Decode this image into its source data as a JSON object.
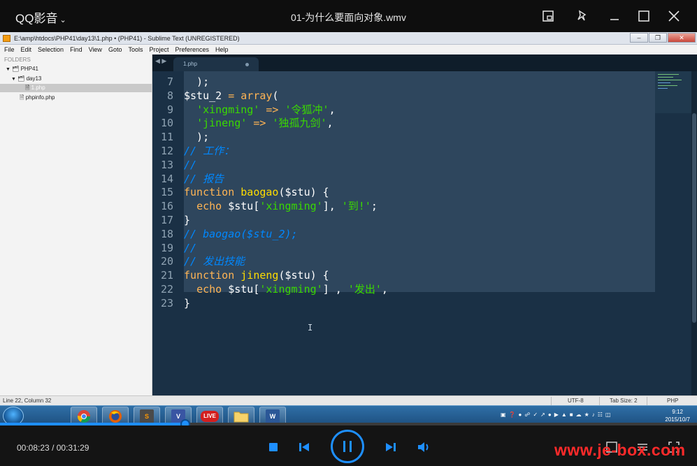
{
  "player": {
    "brand": "QQ影音",
    "video_title": "01-为什么要面向对象.wmv",
    "time_current": "00:08:23",
    "time_separator": "/",
    "time_total": "00:31:29",
    "progress_fraction": 0.266,
    "watermark": "www.je-box.com",
    "accent_color": "#1e8fff"
  },
  "sublime": {
    "window_title": "E:\\amp\\htdocs\\PHP41\\day13\\1.php • (PHP41) - Sublime Text (UNREGISTERED)",
    "menu": [
      "File",
      "Edit",
      "Selection",
      "Find",
      "View",
      "Goto",
      "Tools",
      "Project",
      "Preferences",
      "Help"
    ],
    "sidebar": {
      "header": "FOLDERS",
      "items": [
        {
          "label": "PHP41",
          "type": "folder"
        },
        {
          "label": "day13",
          "type": "folder"
        },
        {
          "label": "1.php",
          "type": "file",
          "selected": true
        },
        {
          "label": "phpinfo.php",
          "type": "file"
        }
      ]
    },
    "tab": {
      "label": "1.php"
    },
    "code_lines": [
      {
        "n": "7",
        "tokens": [
          {
            "t": "  );",
            "c": "w"
          }
        ]
      },
      {
        "n": "8",
        "tokens": [
          {
            "t": "$stu_2 ",
            "c": "w"
          },
          {
            "t": "=",
            "c": "k"
          },
          {
            "t": " ",
            "c": "w"
          },
          {
            "t": "array",
            "c": "k"
          },
          {
            "t": "(",
            "c": "w"
          }
        ]
      },
      {
        "n": "9",
        "tokens": [
          {
            "t": "  ",
            "c": "w"
          },
          {
            "t": "'xingming'",
            "c": "s"
          },
          {
            "t": " ",
            "c": "w"
          },
          {
            "t": "=>",
            "c": "k"
          },
          {
            "t": " ",
            "c": "w"
          },
          {
            "t": "'令狐冲'",
            "c": "s"
          },
          {
            "t": ",",
            "c": "w"
          }
        ]
      },
      {
        "n": "10",
        "tokens": [
          {
            "t": "  ",
            "c": "w"
          },
          {
            "t": "'jineng'",
            "c": "s"
          },
          {
            "t": " ",
            "c": "w"
          },
          {
            "t": "=>",
            "c": "k"
          },
          {
            "t": " ",
            "c": "w"
          },
          {
            "t": "'独孤九剑'",
            "c": "s"
          },
          {
            "t": ",",
            "c": "w"
          }
        ]
      },
      {
        "n": "11",
        "tokens": [
          {
            "t": "  );",
            "c": "w"
          }
        ]
      },
      {
        "n": "12",
        "tokens": [
          {
            "t": "// 工作：",
            "c": "c"
          }
        ]
      },
      {
        "n": "13",
        "tokens": [
          {
            "t": "//",
            "c": "c"
          }
        ]
      },
      {
        "n": "14",
        "tokens": [
          {
            "t": "// 报告",
            "c": "c"
          }
        ]
      },
      {
        "n": "15",
        "tokens": [
          {
            "t": "function",
            "c": "k"
          },
          {
            "t": " ",
            "c": "w"
          },
          {
            "t": "baogao",
            "c": "f"
          },
          {
            "t": "($stu) {",
            "c": "w"
          }
        ]
      },
      {
        "n": "16",
        "tokens": [
          {
            "t": "  ",
            "c": "w"
          },
          {
            "t": "echo",
            "c": "k"
          },
          {
            "t": " $stu[",
            "c": "w"
          },
          {
            "t": "'xingming'",
            "c": "s"
          },
          {
            "t": "], ",
            "c": "w"
          },
          {
            "t": "'到!'",
            "c": "s"
          },
          {
            "t": ";",
            "c": "w"
          }
        ]
      },
      {
        "n": "17",
        "tokens": [
          {
            "t": "}",
            "c": "w"
          }
        ]
      },
      {
        "n": "18",
        "tokens": [
          {
            "t": "// baogao($stu_2);",
            "c": "c"
          }
        ]
      },
      {
        "n": "19",
        "tokens": [
          {
            "t": "//",
            "c": "c"
          }
        ]
      },
      {
        "n": "20",
        "tokens": [
          {
            "t": "// 发出技能",
            "c": "c"
          }
        ]
      },
      {
        "n": "21",
        "tokens": [
          {
            "t": "function",
            "c": "k"
          },
          {
            "t": " ",
            "c": "w"
          },
          {
            "t": "jineng",
            "c": "f"
          },
          {
            "t": "($stu) {",
            "c": "w"
          }
        ]
      },
      {
        "n": "22",
        "tokens": [
          {
            "t": "  ",
            "c": "w"
          },
          {
            "t": "echo",
            "c": "k"
          },
          {
            "t": " $stu[",
            "c": "w"
          },
          {
            "t": "'xingming'",
            "c": "s"
          },
          {
            "t": "] , ",
            "c": "w"
          },
          {
            "t": "'发出'",
            "c": "s"
          },
          {
            "t": ",",
            "c": "w"
          }
        ]
      },
      {
        "n": "23",
        "tokens": [
          {
            "t": "}",
            "c": "w"
          }
        ]
      }
    ],
    "status": {
      "position": "Line 22, Column 32",
      "encoding": "UTF-8",
      "tab_size": "Tab Size: 2",
      "syntax": "PHP"
    }
  },
  "taskbar": {
    "apps": [
      {
        "name": "chrome",
        "label": ""
      },
      {
        "name": "firefox",
        "label": ""
      },
      {
        "name": "sublime",
        "label": "S"
      },
      {
        "name": "visio",
        "label": "V"
      },
      {
        "name": "live",
        "label": "LIVE"
      },
      {
        "name": "explorer",
        "label": ""
      },
      {
        "name": "word",
        "label": "W"
      }
    ],
    "clock_time": "9:12",
    "clock_date": "2015/10/7"
  }
}
